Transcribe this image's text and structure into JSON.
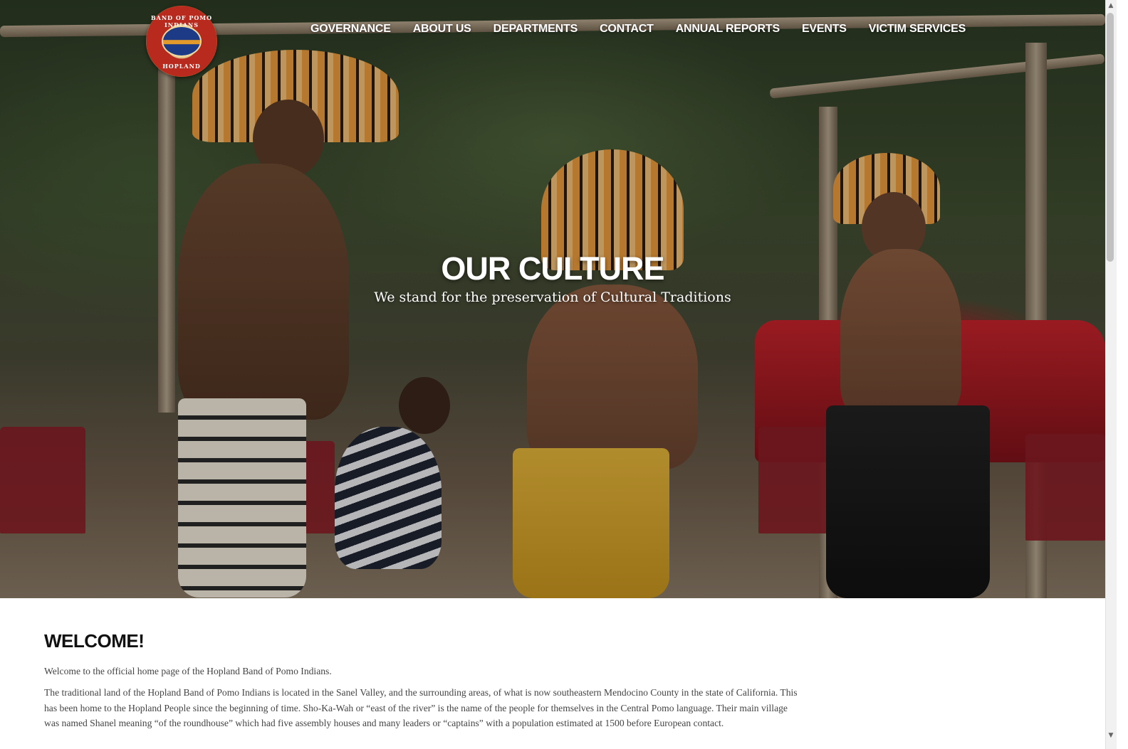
{
  "header": {
    "logo": {
      "ring_text_top": "BAND OF POMO INDIANS",
      "ring_text_bottom": "HOPLAND"
    },
    "nav": [
      {
        "label": "GOVERNANCE"
      },
      {
        "label": "ABOUT US"
      },
      {
        "label": "DEPARTMENTS"
      },
      {
        "label": "CONTACT"
      },
      {
        "label": "ANNUAL REPORTS"
      },
      {
        "label": "EVENTS"
      },
      {
        "label": "VICTIM SERVICES"
      }
    ]
  },
  "hero": {
    "title": "OUR CULTURE",
    "subtitle": "We stand for the preservation of Cultural Traditions"
  },
  "main": {
    "heading": "WELCOME!",
    "paragraphs": [
      "Welcome to the official home page of the Hopland Band of Pomo Indians.",
      "The traditional land of the Hopland Band of Pomo Indians is located in the Sanel Valley, and the surrounding areas, of what is now southeastern Mendocino County in the state of California. This has been home to the Hopland People since the beginning of time. Sho-Ka-Wah or “east of the river” is the name of the people for themselves in the Central Pomo language. Their main village was named Shanel meaning “of the roundhouse” which had five assembly houses and many leaders or “captains” with a population estimated at 1500 before European contact."
    ]
  },
  "colors": {
    "nav_text": "#ffffff",
    "heading_text": "#111111",
    "body_text": "#444444"
  },
  "icons": {
    "scroll_up": "▲",
    "scroll_down": "▼"
  }
}
